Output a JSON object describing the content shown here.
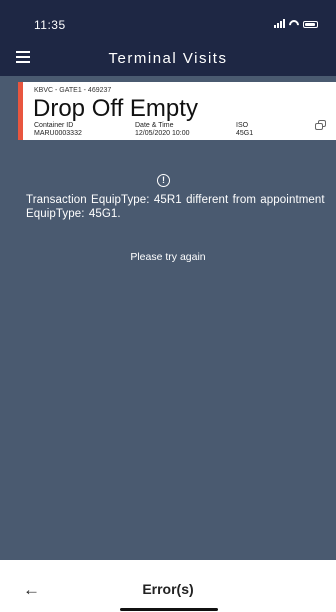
{
  "status_bar": {
    "time": "11:35",
    "icons": [
      "signal-icon",
      "wifi-icon",
      "battery-icon"
    ]
  },
  "header": {
    "title": "Terminal Visits",
    "menu_icon": "hamburger-menu-icon"
  },
  "card": {
    "reference": "KBVC - GATE1 - 469237",
    "title": "Drop Off Empty",
    "container_id_label": "Container ID",
    "container_id_value": "MARU0003332",
    "date_time_label": "Date & Time",
    "date_time_value": "12/05/2020 10:00",
    "iso_label": "ISO",
    "iso_value": "45G1",
    "copy_icon": "copy-icon"
  },
  "error": {
    "icon": "info-icon",
    "icon_glyph": "!",
    "message": "Transaction EquipType: 45R1 different from appointment EquipType: 45G1.",
    "retry": "Please try again"
  },
  "footer": {
    "back_icon": "left-arrow-icon",
    "back_glyph": "←",
    "title": "Error(s)"
  },
  "colors": {
    "header_bg": "#1e2744",
    "content_bg": "#4a5a70",
    "card_accent": "#e8563f",
    "text_light": "#ffffff"
  }
}
